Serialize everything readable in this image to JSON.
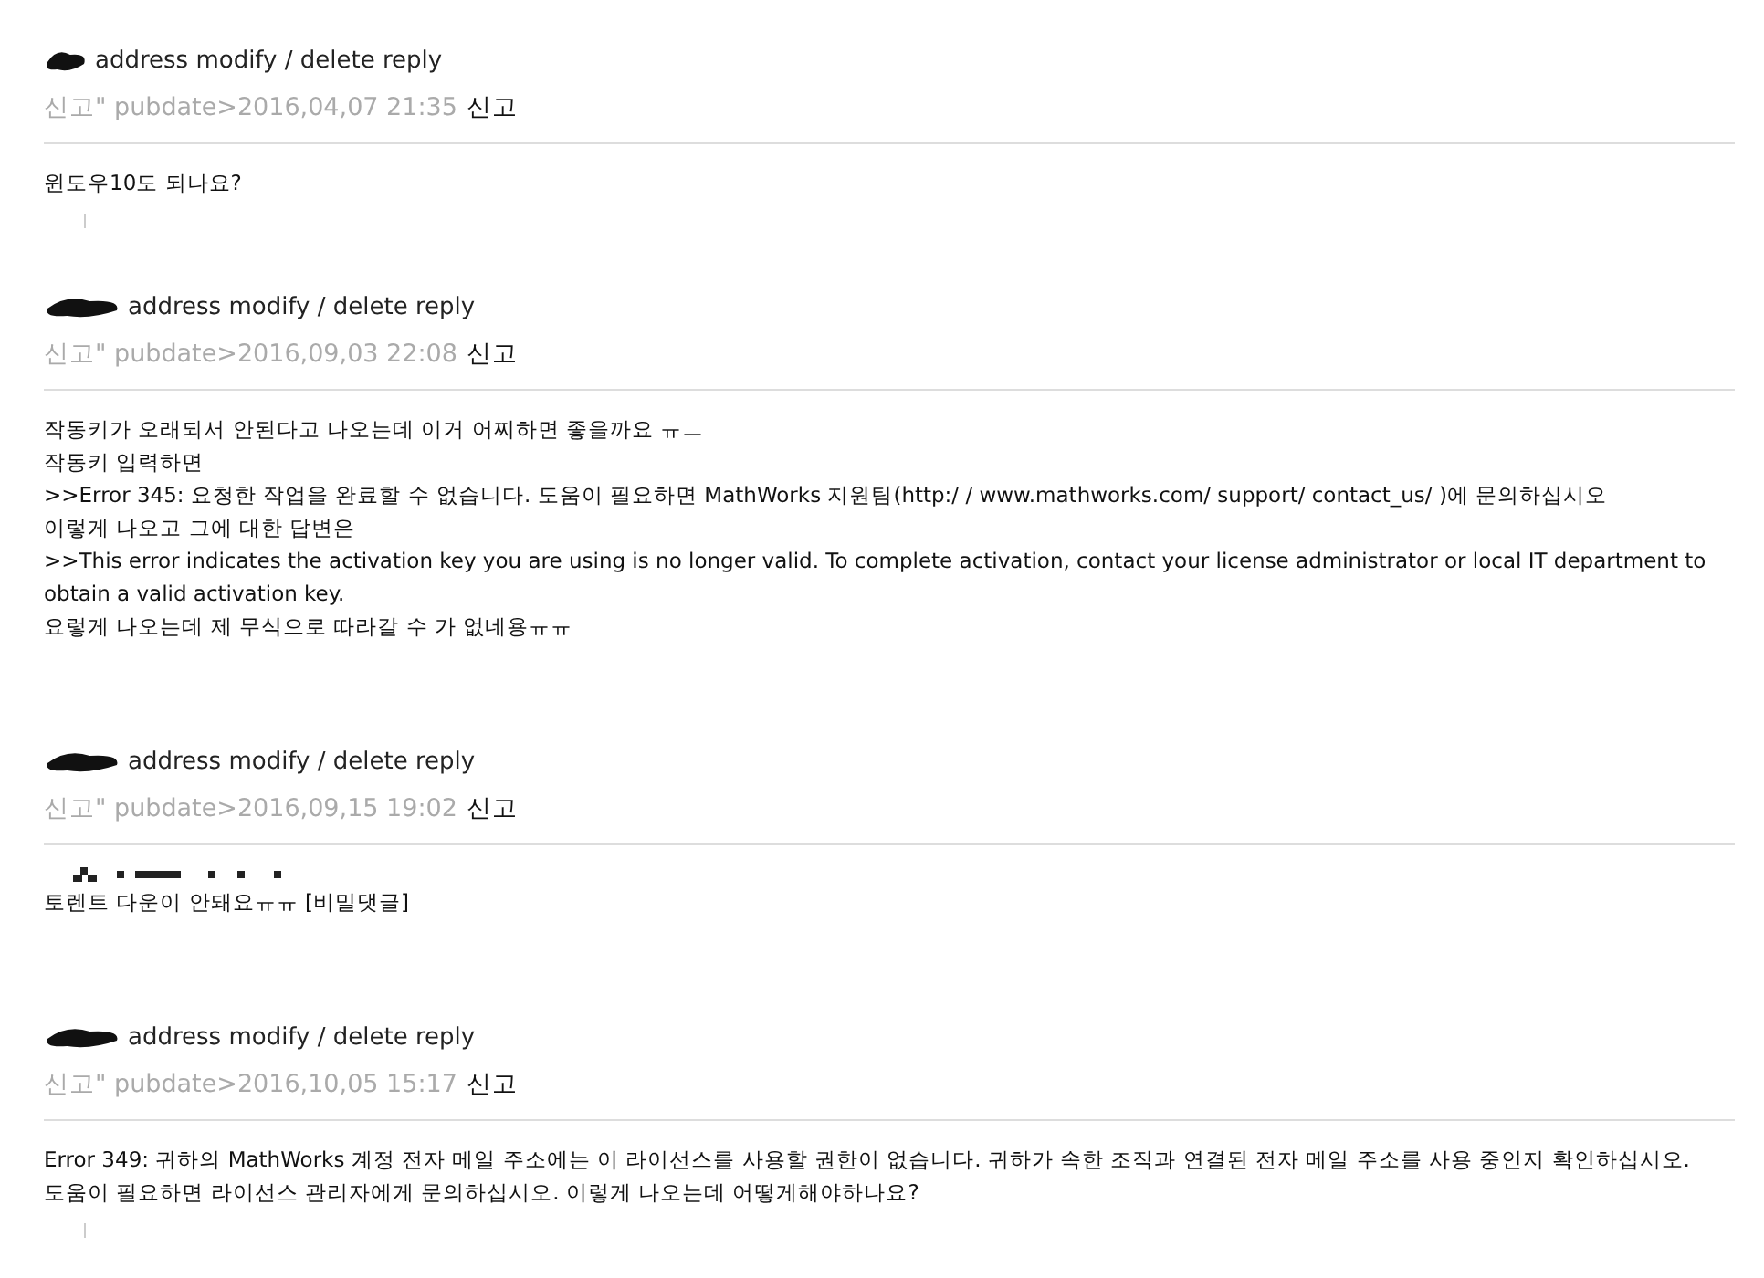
{
  "comments": [
    {
      "actions": "address modify / delete reply",
      "meta": "신고\" pubdate>2016,04,07 21:35",
      "report": "신고",
      "marker": true,
      "body": [
        "윈도우10도 되나요?"
      ]
    },
    {
      "actions": "address modify / delete reply",
      "meta": "신고\" pubdate>2016,09,03 22:08",
      "report": "신고",
      "body": [
        "작동키가 오래되서 안된다고 나오는데 이거 어찌하면 좋을까요 ㅠㅡ",
        "작동키 입력하면",
        ">>Error 345: 요청한 작업을 완료할 수 없습니다. 도움이 필요하면 MathWorks 지원팀(http:/ / www.mathworks.com/ support/ contact_us/ )에 문의하십시오",
        "이렇게 나오고 그에 대한 답변은",
        ">>This error indicates the activation key you are using is no longer valid. To complete activation, contact your license administrator or local IT department to obtain a valid activation key.",
        "요렇게 나오는데 제 무식으로 따라갈 수 가 없네용ㅠㅠ"
      ]
    },
    {
      "actions": "address modify / delete reply",
      "meta": "신고\" pubdate>2016,09,15 19:02",
      "report": "신고",
      "pixelated_line": true,
      "body": [
        "토렌트 다운이 안돼요ㅠㅠ [비밀댓글]"
      ]
    },
    {
      "actions": "address modify / delete reply",
      "meta": "신고\" pubdate>2016,10,05 15:17",
      "report": "신고",
      "marker": true,
      "body": [
        "Error 349: 귀하의 MathWorks 계정 전자 메일 주소에는 이 라이선스를 사용할 권한이 없습니다. 귀하가 속한 조직과 연결된 전자 메일 주소를 사용 중인지 확인하십시오. 도움이 필요하면 라이선스 관리자에게 문의하십시오. 이렇게 나오는데 어떻게해야하나요?"
      ]
    }
  ]
}
